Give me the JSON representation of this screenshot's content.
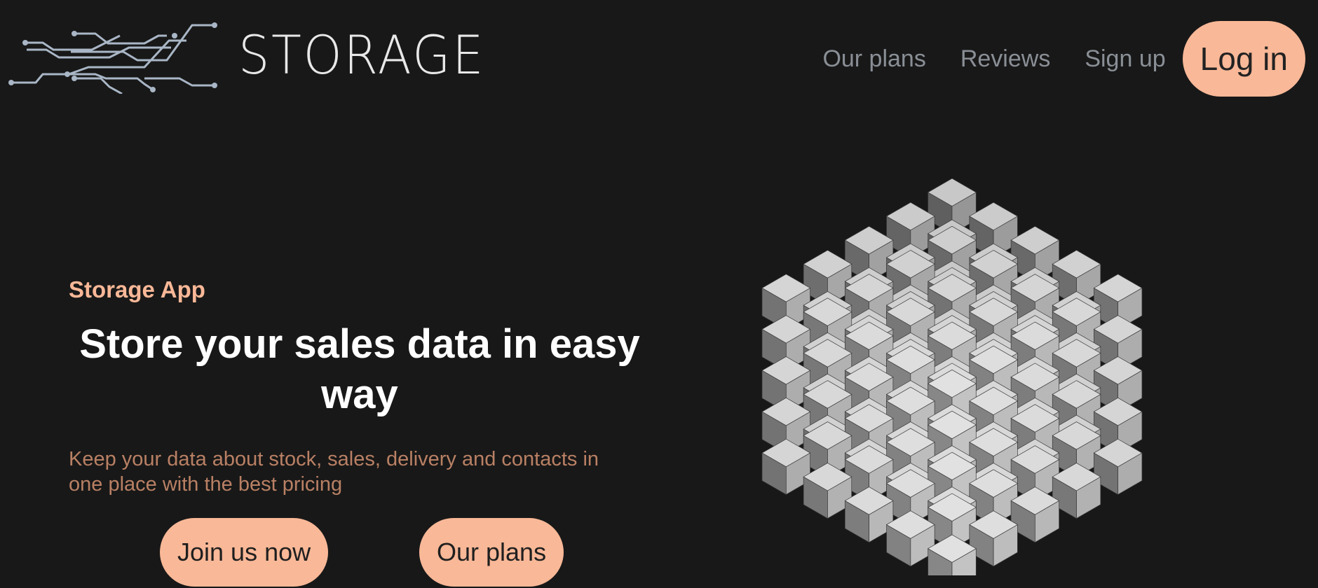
{
  "header": {
    "logo_text": "STORAGE",
    "nav": {
      "plans": "Our plans",
      "reviews": "Reviews",
      "signup": "Sign up",
      "login": "Log in"
    }
  },
  "hero": {
    "eyebrow": "Storage App",
    "title": "Store your sales data in easy way",
    "description": "Keep your data about stock, sales, delivery and contacts in one place with the best pricing",
    "buttons": {
      "join": "Join us now",
      "plans": "Our plans"
    }
  },
  "colors": {
    "background": "#181818",
    "accent": "#f9b897",
    "description_text": "#b98064",
    "nav_text": "#8a8f96"
  },
  "icons": {
    "logo": "circuit-lines-icon",
    "hero_image": "cube-grid-icon"
  }
}
